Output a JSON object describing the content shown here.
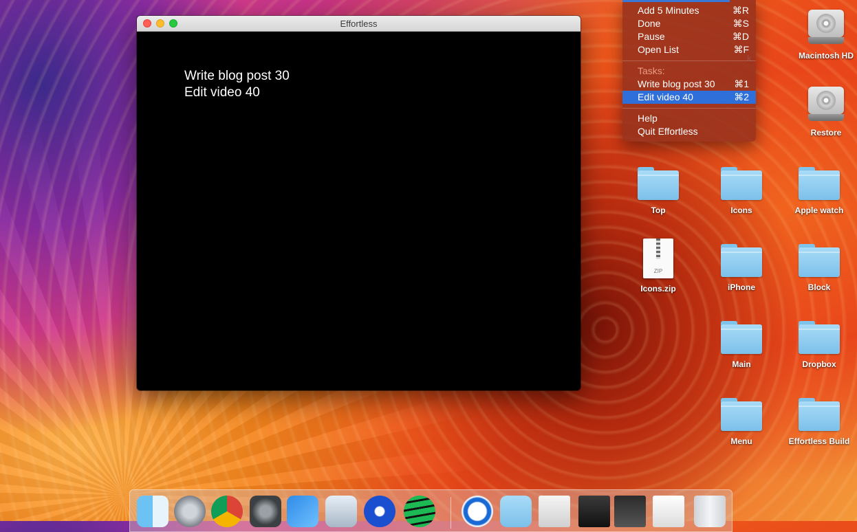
{
  "window": {
    "title": "Effortless",
    "tasks": [
      "Write blog post 30",
      "Edit video 40"
    ]
  },
  "menu": {
    "items": [
      {
        "label": "Add 5 Minutes",
        "shortcut": "⌘R"
      },
      {
        "label": "Done",
        "shortcut": "⌘S"
      },
      {
        "label": "Pause",
        "shortcut": "⌘D"
      },
      {
        "label": "Open List",
        "shortcut": "⌘F"
      }
    ],
    "tasks_header": "Tasks:",
    "task_items": [
      {
        "label": "Write blog post 30",
        "shortcut": "⌘1",
        "selected": false
      },
      {
        "label": "Edit video 40",
        "shortcut": "⌘2",
        "selected": true
      }
    ],
    "footer_items": [
      {
        "label": "Help"
      },
      {
        "label": "Quit Effortless"
      }
    ]
  },
  "desktop": {
    "partial_label": "k",
    "icons": [
      {
        "label": "Macintosh HD",
        "kind": "drive-icon"
      },
      {
        "label": "Restore",
        "kind": "drive-icon"
      },
      {
        "label": "Top",
        "kind": "folder-icon"
      },
      {
        "label": "Icons",
        "kind": "folder-icon"
      },
      {
        "label": "Apple watch",
        "kind": "folder-icon"
      },
      {
        "label": "Icons.zip",
        "kind": "zip-file-icon",
        "badge": "ZIP"
      },
      {
        "label": "iPhone",
        "kind": "folder-icon"
      },
      {
        "label": "Block",
        "kind": "folder-icon"
      },
      {
        "label": "Main",
        "kind": "folder-icon"
      },
      {
        "label": "Dropbox",
        "kind": "folder-icon"
      },
      {
        "label": "Menu",
        "kind": "folder-icon"
      },
      {
        "label": "Effortless Build",
        "kind": "folder-icon"
      }
    ]
  },
  "dock": {
    "apps": [
      "finder-icon",
      "launchpad-icon",
      "chrome-icon",
      "system-preferences-icon",
      "xcode-icon",
      "preview-icon",
      "screen-recorder-icon",
      "spotify-icon",
      "1password-icon",
      "downloads-folder-icon",
      "browser-window-icon",
      "screenshot-thumbnail-icon",
      "terminal-thumbnail-icon",
      "document-thumbnail-icon",
      "trash-icon"
    ]
  },
  "colors": {
    "menu_highlight": "#2f6fd9",
    "window_background": "#000000",
    "folder_blue": "#8ccdf0"
  }
}
